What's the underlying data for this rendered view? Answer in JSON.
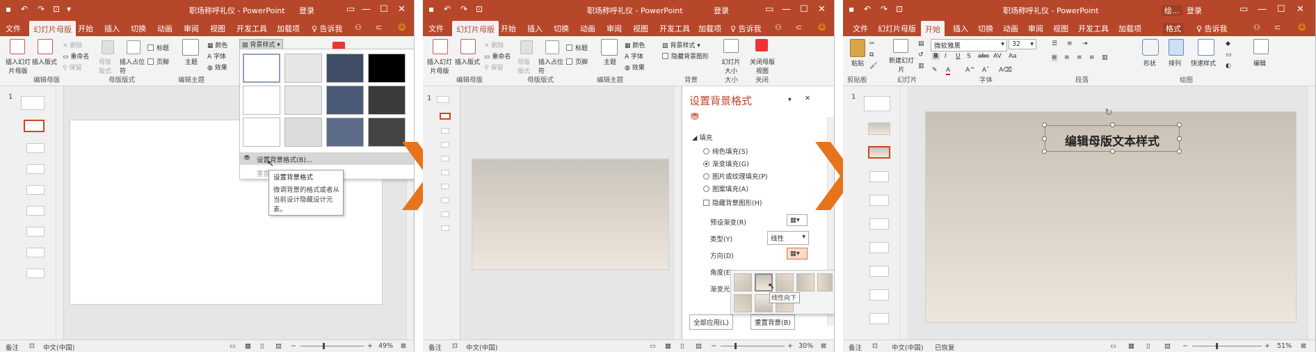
{
  "app": {
    "title": "职场称呼礼仪 - PowerPoint",
    "login": "登录",
    "accent": "#b7472a"
  },
  "tabs_master": [
    "文件",
    "幻灯片母版",
    "开始",
    "插入",
    "切换",
    "动画",
    "审阅",
    "视图",
    "开发工具",
    "加载项"
  ],
  "tabs_home": [
    "文件",
    "幻灯片母版",
    "开始",
    "插入",
    "切换",
    "动画",
    "审阅",
    "视图",
    "开发工具",
    "加载项",
    "格式"
  ],
  "tell_me": "♀ 告诉我",
  "tell_me_long": "♀ 告诉我",
  "p3_truncated": "绘...",
  "ribbon_master": {
    "insert_master": "插入幻灯片母版",
    "insert_layout": "插入版式",
    "delete": "删除",
    "rename": "重命名",
    "preserve": "保留",
    "master_layout": "母版版式",
    "insert_placeholder": "插入占位符",
    "title": "标题",
    "footer": "页脚",
    "theme": "主题",
    "colors": "颜色",
    "fonts": "字体",
    "effects": "效果",
    "bg_styles": "背景样式",
    "hide_bg": "隐藏背景图形",
    "slide_size": "幻灯片大小",
    "close_master": "关闭母版视图",
    "g_edit_master": "编辑母版",
    "g_master_layout": "母版版式",
    "g_edit_theme": "编辑主题",
    "g_background": "背景",
    "g_size": "大小",
    "g_close": "关闭"
  },
  "ribbon_home": {
    "paste": "粘贴",
    "new_slide": "新建幻灯片",
    "font_name": "微软雅黑",
    "font_size": "32",
    "shapes": "形状",
    "arrange": "排列",
    "quick_styles": "快速样式",
    "editing": "编辑",
    "g_clipboard": "剪贴板",
    "g_slides": "幻灯片",
    "g_font": "字体",
    "g_paragraph": "段落",
    "g_drawing": "绘图"
  },
  "bg_menu": {
    "format_bg": "设置背景格式(B)...",
    "reset_bg": "重置幻灯片背景(R)",
    "tooltip_title": "设置背景格式",
    "tooltip_body_1": "微调背景的格式或者从",
    "tooltip_body_2": "当前设计隐藏设计元",
    "tooltip_body_3": "素。",
    "swatch_colors": [
      "#ffffff",
      "#e6e6e6",
      "#3f4e66",
      "#000000",
      "#ffffff",
      "#e6e6e6",
      "#4a5a78",
      "#3a3a3a",
      "#ffffff",
      "#dcdcdc",
      "#5c6c88",
      "#444444"
    ]
  },
  "format_pane": {
    "title": "设置背景格式",
    "section_fill": "填充",
    "solid": "纯色填充(S)",
    "gradient": "渐变填充(G)",
    "picture": "图片或纹理填充(P)",
    "pattern": "图案填充(A)",
    "hide_bg": "隐藏背景图形(H)",
    "preset": "预设渐变(R)",
    "type": "类型(Y)",
    "type_value": "线性",
    "direction": "方向(D)",
    "angle": "角度(E)",
    "stops": "渐变光圈",
    "apply_all": "全部应用(L)",
    "reset": "重置背景(B)",
    "direction_tip": "线性向下"
  },
  "slide_text": "编辑母版文本样式",
  "status": {
    "notes": "备注",
    "lang": "中文(中国)",
    "recovered": "已恢复",
    "zoom1": "49%",
    "zoom2": "30%",
    "zoom3": "51%"
  },
  "slide_num": "1"
}
